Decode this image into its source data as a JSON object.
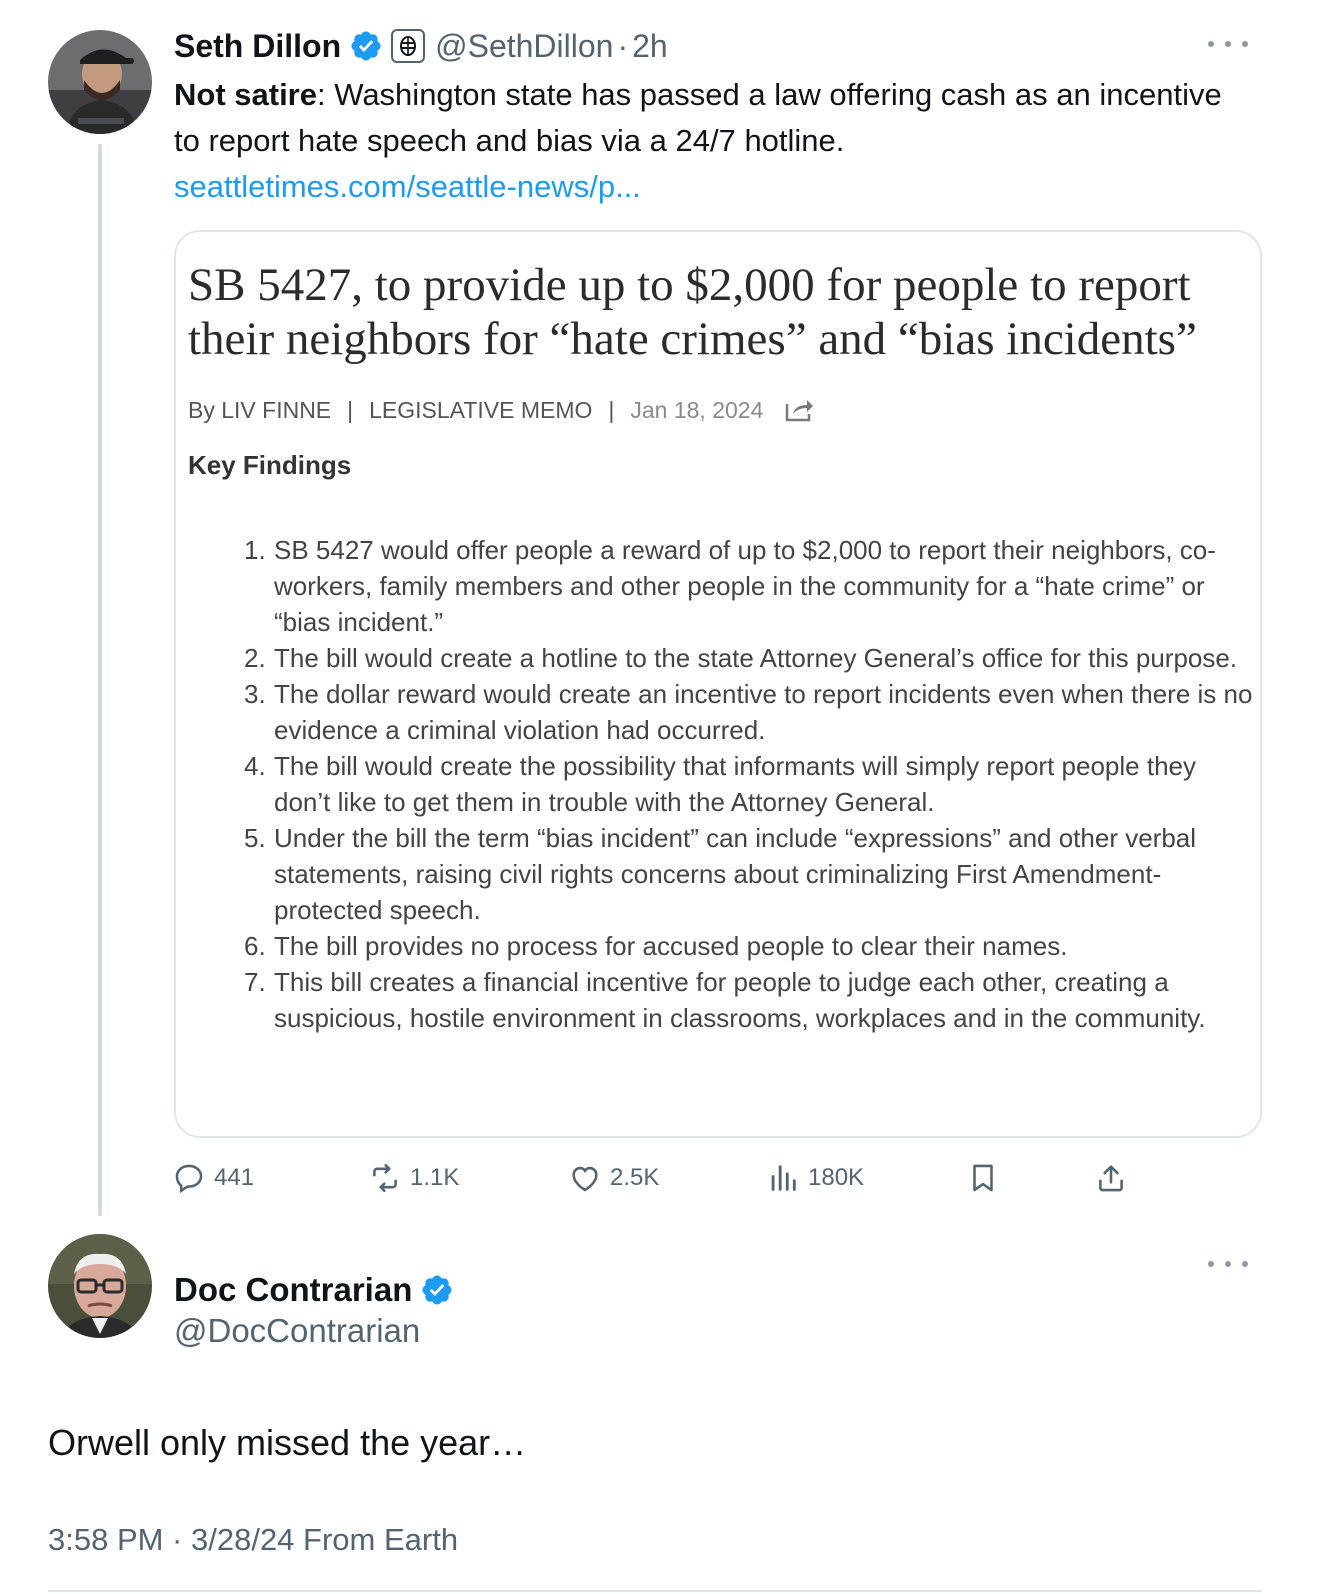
{
  "tweet": {
    "author_name": "Seth Dillon",
    "author_handle": "@SethDillon",
    "separator": "·",
    "time_ago": "2h",
    "text_bold": "Not satire",
    "text_rest": ": Washington state has passed a law offering cash as an incentive to report hate speech and bias via a 24/7 hotline.",
    "link": "seattletimes.com/seattle-news/p...",
    "card": {
      "headline": "SB 5427, to provide up to $2,000 for people to report their neighbors for “hate crimes” and “bias incidents”",
      "byline_author": "By LIV FINNE",
      "byline_sep": "|",
      "byline_type": "LEGISLATIVE MEMO",
      "byline_date": "Jan 18, 2024",
      "key_findings_heading": "Key Findings",
      "findings": [
        {
          "num": "1.",
          "text": "SB 5427 would offer people a reward of up to $2,000 to report their neighbors, co-workers, family members and other people in the community for a “hate crime” or “bias incident.”"
        },
        {
          "num": "2.",
          "text": "The bill would create a hotline to the state Attorney General’s office for this purpose."
        },
        {
          "num": "3.",
          "text": "The dollar reward would create an incentive to report incidents even when there is no evidence a criminal violation had occurred."
        },
        {
          "num": "4.",
          "text": "The bill would create the possibility that informants will simply report people they don’t like to get them in trouble with the Attorney General."
        },
        {
          "num": "5.",
          "text": "Under the bill the term “bias incident” can include “expressions” and other verbal statements, raising civil rights concerns about criminalizing First Amendment-protected speech."
        },
        {
          "num": "6.",
          "text": "The bill provides no process for accused people to clear their names."
        },
        {
          "num": "7.",
          "text": "This bill creates a financial incentive for people to judge each other, creating a suspicious, hostile environment in classrooms, workplaces and in the community."
        }
      ]
    },
    "stats": {
      "replies": "441",
      "reposts": "1.1K",
      "likes": "2.5K",
      "views": "180K"
    }
  },
  "reply": {
    "author_name": "Doc Contrarian",
    "author_handle": "@DocContrarian",
    "text": "Orwell only missed the year…",
    "meta": "3:58 PM · 3/28/24 From Earth"
  },
  "icons": {
    "verified": "verified-badge-icon",
    "affiliate": "babylon-bee-affiliate-icon",
    "more": "more-dots-icon",
    "share_article": "share-arrow-icon",
    "reply": "reply-bubble-icon",
    "repost": "repost-icon",
    "like": "heart-icon",
    "views": "views-bar-chart-icon",
    "bookmark": "bookmark-icon",
    "share": "share-upload-icon"
  },
  "colors": {
    "accent_blue": "#1d9bf0",
    "secondary_text": "#536471",
    "thread_line": "#cfd9de"
  }
}
